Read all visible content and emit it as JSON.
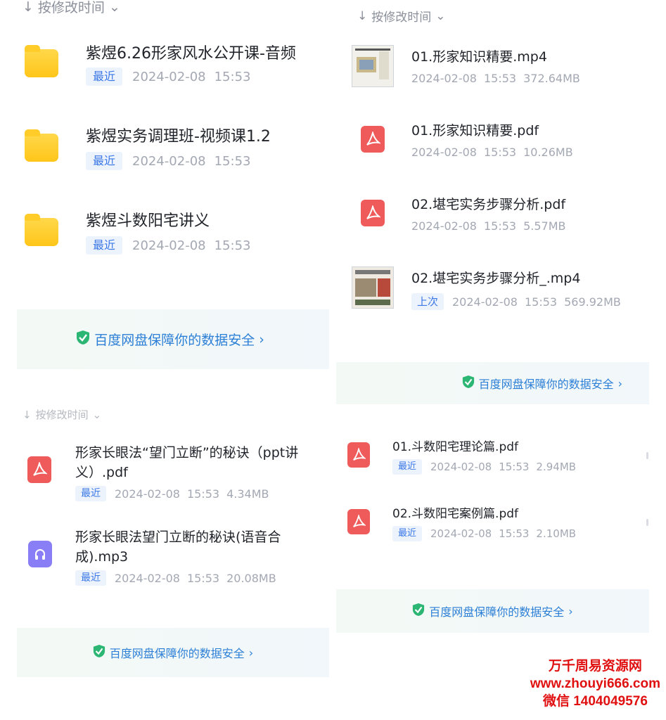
{
  "panels": {
    "p1": {
      "sort_label": "按修改时间",
      "items": [
        {
          "name": "紫煜6.26形家风水公开课-音频",
          "badge": "最近",
          "date": "2024-02-08",
          "time": "15:53",
          "icon": "folder-icon"
        },
        {
          "name": "紫煜实务调理班-视频课1.2",
          "badge": "最近",
          "date": "2024-02-08",
          "time": "15:53",
          "icon": "folder-icon"
        },
        {
          "name": "紫煜斗数阳宅讲义",
          "badge": "最近",
          "date": "2024-02-08",
          "time": "15:53",
          "icon": "folder-icon"
        }
      ],
      "banner": "百度网盘保障你的数据安全"
    },
    "p2": {
      "sort_label": "按修改时间",
      "items": [
        {
          "name": "01.形家知识精要.mp4",
          "badge": "",
          "date": "2024-02-08",
          "time": "15:53",
          "size": "372.64MB",
          "icon": "video-thumbnail-icon"
        },
        {
          "name": "01.形家知识精要.pdf",
          "badge": "",
          "date": "2024-02-08",
          "time": "15:53",
          "size": "10.26MB",
          "icon": "pdf-icon"
        },
        {
          "name": "02.堪宅实务步骤分析.pdf",
          "badge": "",
          "date": "2024-02-08",
          "time": "15:53",
          "size": "5.57MB",
          "icon": "pdf-icon"
        },
        {
          "name": "02.堪宅实务步骤分析_.mp4",
          "badge": "上次",
          "date": "2024-02-08",
          "time": "15:53",
          "size": "569.92MB",
          "icon": "video-thumbnail-icon"
        }
      ],
      "banner": "百度网盘保障你的数据安全"
    },
    "p3": {
      "sort_label": "按修改时间",
      "items": [
        {
          "name_line1": "形家长眼法“望门立断”的秘诀（ppt讲",
          "name_line2": "义）.pdf",
          "badge": "最近",
          "date": "2024-02-08",
          "time": "15:53",
          "size": "4.34MB",
          "icon": "pdf-icon"
        },
        {
          "name_line1": "形家长眼法望门立断的秘诀(语音合",
          "name_line2": "成).mp3",
          "badge": "最近",
          "date": "2024-02-08",
          "time": "15:53",
          "size": "20.08MB",
          "icon": "audio-file-icon"
        }
      ],
      "banner": "百度网盘保障你的数据安全"
    },
    "p4": {
      "items": [
        {
          "name": "01.斗数阳宅理论篇.pdf",
          "badge": "最近",
          "date": "2024-02-08",
          "time": "15:53",
          "size": "2.94MB",
          "icon": "pdf-icon"
        },
        {
          "name": "02.斗数阳宅案例篇.pdf",
          "badge": "最近",
          "date": "2024-02-08",
          "time": "15:53",
          "size": "2.10MB",
          "icon": "pdf-icon"
        }
      ],
      "banner": "百度网盘保障你的数据安全"
    }
  },
  "watermark": {
    "line1": "万千周易资源网",
    "line2": "www.zhouyi666.com",
    "line3": "微信 1404049576"
  },
  "colors": {
    "badge_text": "#3b78e7",
    "banner_text": "#2c7fd6",
    "watermark": "#e01010",
    "pdf_icon": "#ef5b5b",
    "folder_icon": "#ffc61a",
    "audio_icon": "#8a7ef6"
  }
}
